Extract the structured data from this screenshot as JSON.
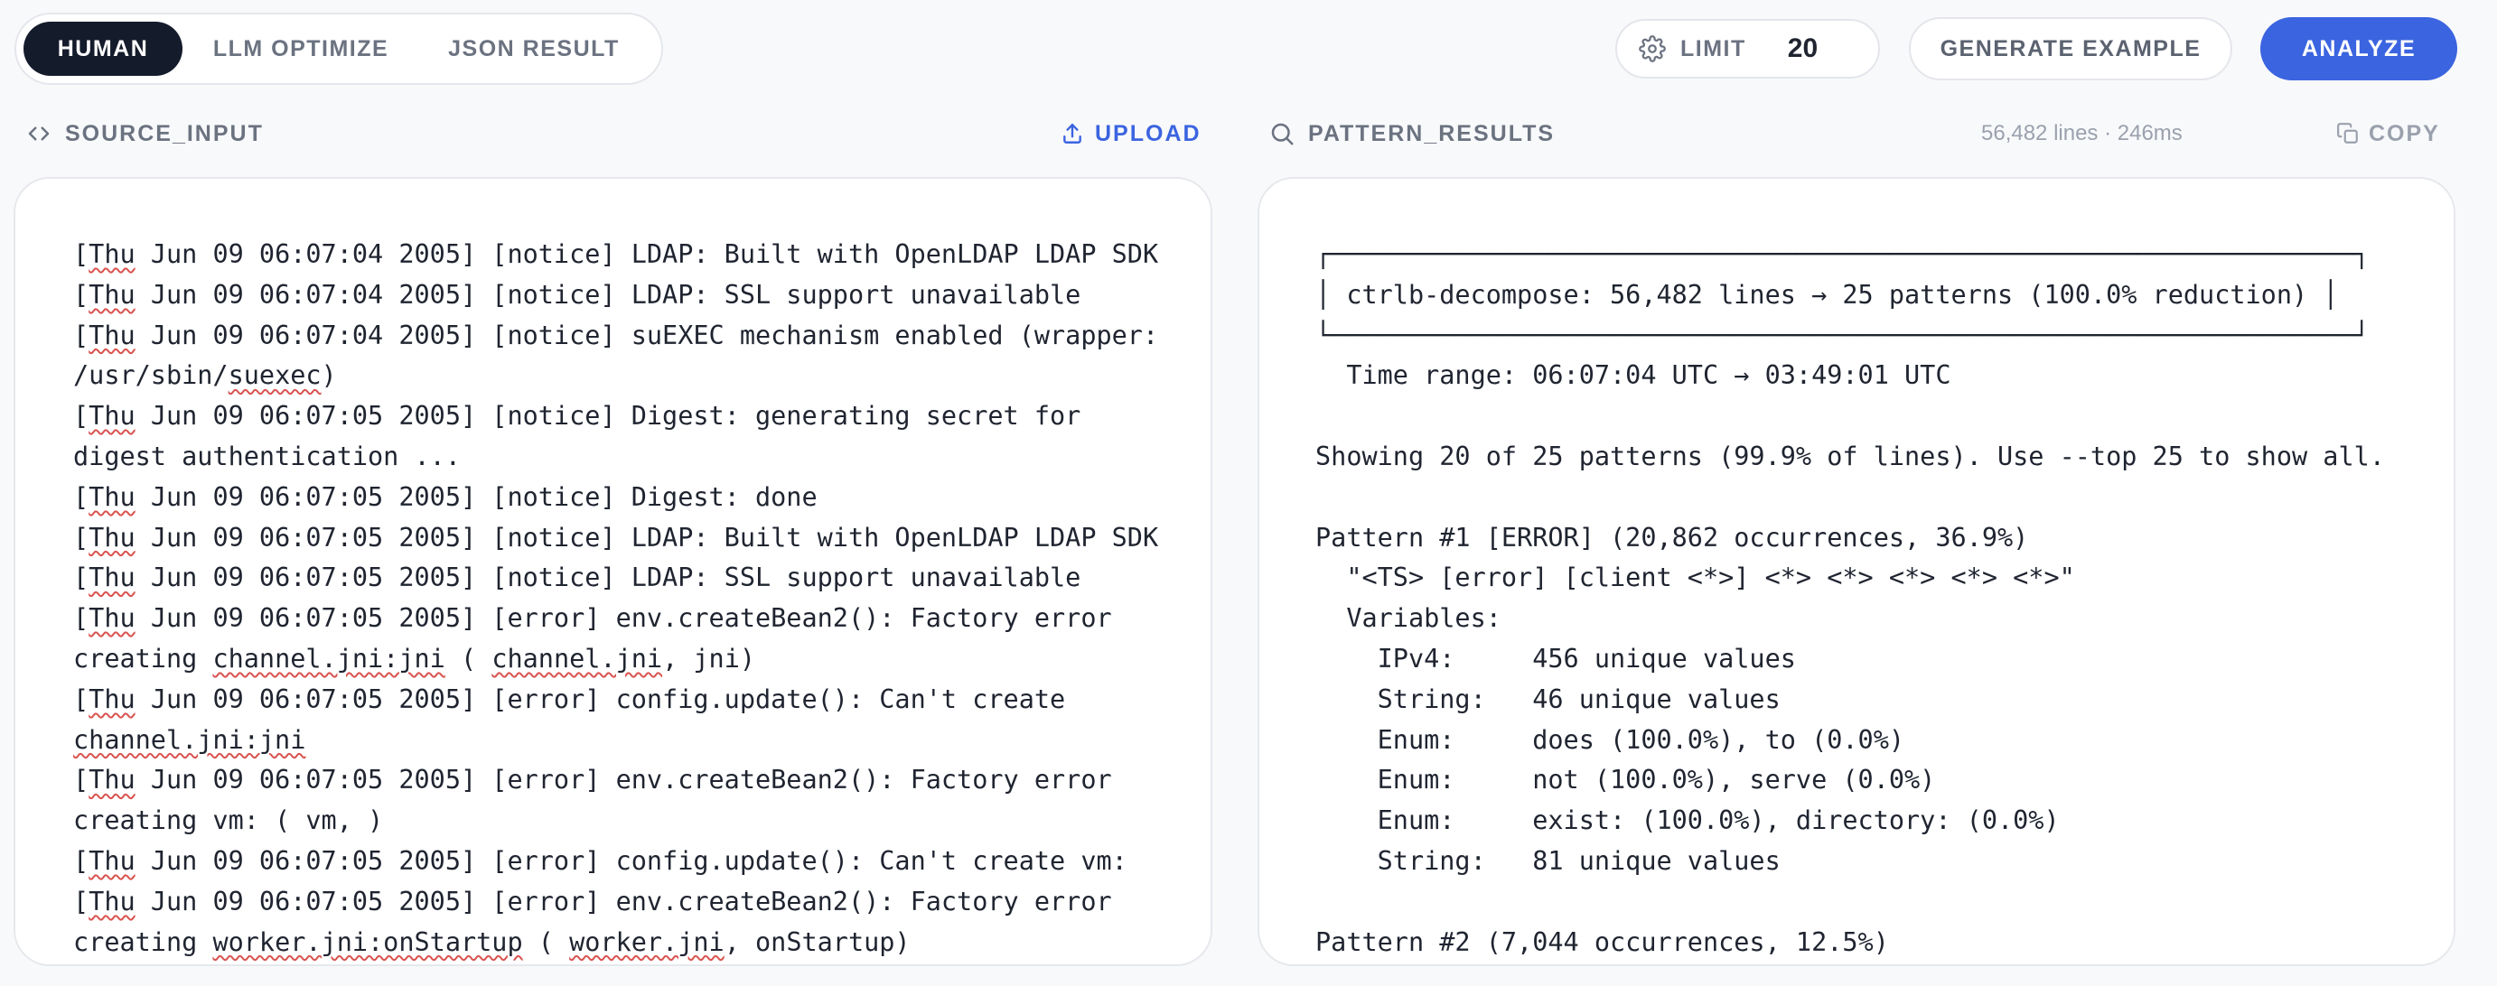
{
  "header": {
    "mode_tabs": [
      {
        "label": "HUMAN",
        "active": true
      },
      {
        "label": "LLM OPTIMIZE",
        "active": false
      },
      {
        "label": "JSON RESULT",
        "active": false
      }
    ],
    "limit": {
      "label": "LIMIT",
      "value": "20",
      "icon": "gear-icon"
    },
    "generate_label": "GENERATE EXAMPLE",
    "analyze_label": "ANALYZE"
  },
  "colors": {
    "accent": "#3b64e0",
    "active_tab": "#141b2b",
    "muted_text": "#6b7280"
  },
  "source": {
    "title": "SOURCE_INPUT",
    "title_icon": "code-icon",
    "upload_label": "UPLOAD",
    "upload_icon": "upload-icon",
    "lines": [
      "[Thu Jun 09 06:07:04 2005] [notice] LDAP: Built with OpenLDAP LDAP SDK",
      "[Thu Jun 09 06:07:04 2005] [notice] LDAP: SSL support unavailable",
      "[Thu Jun 09 06:07:04 2005] [notice] suEXEC mechanism enabled (wrapper:",
      "/usr/sbin/suexec)",
      "[Thu Jun 09 06:07:05 2005] [notice] Digest: generating secret for",
      "digest authentication ...",
      "[Thu Jun 09 06:07:05 2005] [notice] Digest: done",
      "[Thu Jun 09 06:07:05 2005] [notice] LDAP: Built with OpenLDAP LDAP SDK",
      "[Thu Jun 09 06:07:05 2005] [notice] LDAP: SSL support unavailable",
      "[Thu Jun 09 06:07:05 2005] [error] env.createBean2(): Factory error",
      "creating channel.jni:jni ( channel.jni, jni)",
      "[Thu Jun 09 06:07:05 2005] [error] config.update(): Can't create",
      "channel.jni:jni",
      "[Thu Jun 09 06:07:05 2005] [error] env.createBean2(): Factory error",
      "creating vm: ( vm, )",
      "[Thu Jun 09 06:07:05 2005] [error] config.update(): Can't create vm:",
      "[Thu Jun 09 06:07:05 2005] [error] env.createBean2(): Factory error",
      "creating worker.jni:onStartup ( worker.jni, onStartup)"
    ]
  },
  "results": {
    "title": "PATTERN_RESULTS",
    "title_icon": "search-icon",
    "stats": "56,482 lines · 246ms",
    "copy_label": "COPY",
    "copy_icon": "copy-icon",
    "lines": [
      "┌──────────────────────────────────────────────────────────────────┐",
      "│ ctrlb-decompose: 56,482 lines → 25 patterns (100.0% reduction) │",
      "└──────────────────────────────────────────────────────────────────┘",
      "  Time range: 06:07:04 UTC → 03:49:01 UTC",
      "",
      "Showing 20 of 25 patterns (99.9% of lines). Use --top 25 to show all.",
      "",
      "Pattern #1 [ERROR] (20,862 occurrences, 36.9%)",
      "  \"<TS> [error] [client <*>] <*> <*> <*> <*> <*>\"",
      "  Variables:",
      "    IPv4:     456 unique values",
      "    String:   46 unique values",
      "    Enum:     does (100.0%), to (0.0%)",
      "    Enum:     not (100.0%), serve (0.0%)",
      "    Enum:     exist: (100.0%), directory: (0.0%)",
      "    String:   81 unique values",
      "",
      "Pattern #2 (7,044 occurrences, 12.5%)"
    ]
  }
}
